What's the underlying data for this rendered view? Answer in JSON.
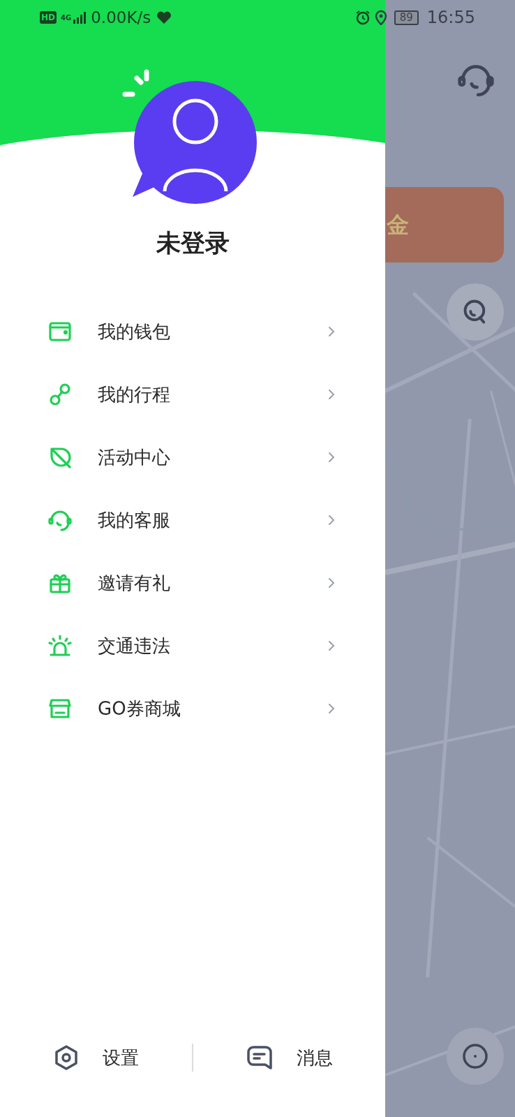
{
  "status_bar": {
    "hd": "HD",
    "network": "4G",
    "speed": "0.00K/s",
    "battery": "89",
    "time": "16:55"
  },
  "drawer": {
    "profile": {
      "name": "未登录"
    },
    "menu": [
      {
        "label": "我的钱包",
        "kind": "wallet"
      },
      {
        "label": "我的行程",
        "kind": "route"
      },
      {
        "label": "活动中心",
        "kind": "leaf"
      },
      {
        "label": "我的客服",
        "kind": "support"
      },
      {
        "label": "邀请有礼",
        "kind": "gift"
      },
      {
        "label": "交通违法",
        "kind": "alarm"
      },
      {
        "label": "GO券商城",
        "kind": "shop"
      }
    ],
    "footer": [
      {
        "label": "设置",
        "kind": "settings"
      },
      {
        "label": "消息",
        "kind": "message"
      }
    ]
  },
  "map_screen": {
    "banner_text": "金"
  }
}
